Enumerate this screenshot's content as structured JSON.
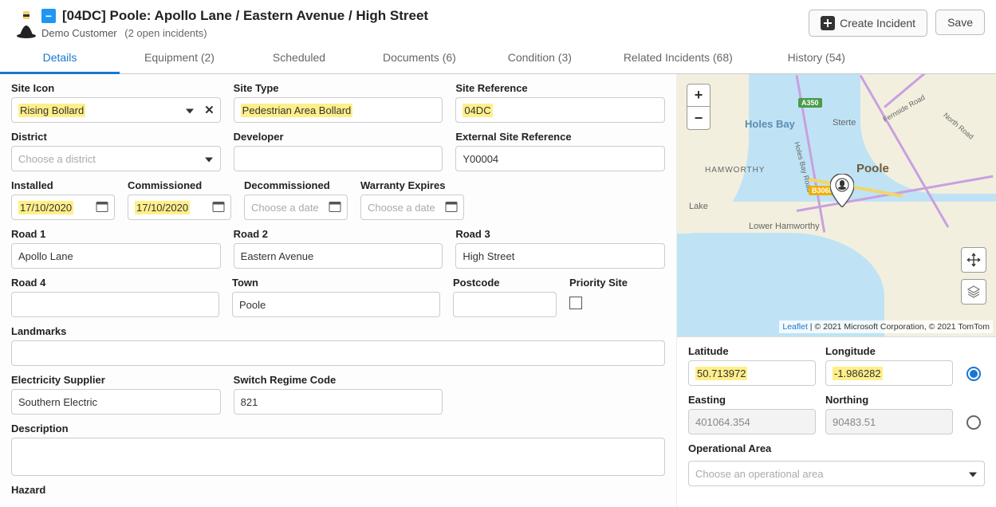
{
  "header": {
    "title": "[04DC] Poole: Apollo Lane / Eastern Avenue / High Street",
    "customer": "Demo Customer",
    "open_incidents": "(2 open incidents)",
    "create_incident": "Create Incident",
    "save": "Save"
  },
  "tabs": {
    "details": "Details",
    "equipment": "Equipment (2)",
    "scheduled": "Scheduled",
    "documents": "Documents (6)",
    "condition": "Condition (3)",
    "related": "Related Incidents (68)",
    "history": "History (54)"
  },
  "labels": {
    "site_icon": "Site Icon",
    "site_type": "Site Type",
    "site_reference": "Site Reference",
    "district": "District",
    "developer": "Developer",
    "external_site_reference": "External Site Reference",
    "installed": "Installed",
    "commissioned": "Commissioned",
    "decommissioned": "Decommissioned",
    "warranty_expires": "Warranty Expires",
    "road1": "Road 1",
    "road2": "Road 2",
    "road3": "Road 3",
    "road4": "Road 4",
    "town": "Town",
    "postcode": "Postcode",
    "priority_site": "Priority Site",
    "landmarks": "Landmarks",
    "electricity_supplier": "Electricity Supplier",
    "switch_regime_code": "Switch Regime Code",
    "description": "Description",
    "hazard": "Hazard",
    "latitude": "Latitude",
    "longitude": "Longitude",
    "easting": "Easting",
    "northing": "Northing",
    "operational_area": "Operational Area"
  },
  "values": {
    "site_icon": "Rising Bollard",
    "site_type": "Pedestrian Area Bollard",
    "site_reference": "04DC",
    "district_placeholder": "Choose a district",
    "developer": "",
    "external_site_reference": "Y00004",
    "installed": "17/10/2020",
    "commissioned": "17/10/2020",
    "date_placeholder": "Choose a date",
    "road1": "Apollo Lane",
    "road2": "Eastern Avenue",
    "road3": "High Street",
    "road4": "",
    "town": "Poole",
    "postcode": "",
    "landmarks": "",
    "electricity_supplier": "Southern Electric",
    "switch_regime_code": "821",
    "description": "",
    "latitude": "50.713972",
    "longitude": "-1.986282",
    "easting": "401064.354",
    "northing": "90483.51",
    "operational_area_placeholder": "Choose an operational area"
  },
  "map": {
    "holes_bay": "Holes Bay",
    "sterte": "Sterte",
    "hamworthy": "HAMWORTHY",
    "holes_bay_road": "Holes Bay Road",
    "fernside_road": "Fernside Road",
    "north_road": "North Road",
    "poole": "Poole",
    "lake": "Lake",
    "lower_hamworthy": "Lower Hamworthy",
    "a350": "A350",
    "b3068": "B3068",
    "leaflet": "Leaflet",
    "attrib": " | © 2021 Microsoft Corporation, © 2021 TomTom"
  }
}
